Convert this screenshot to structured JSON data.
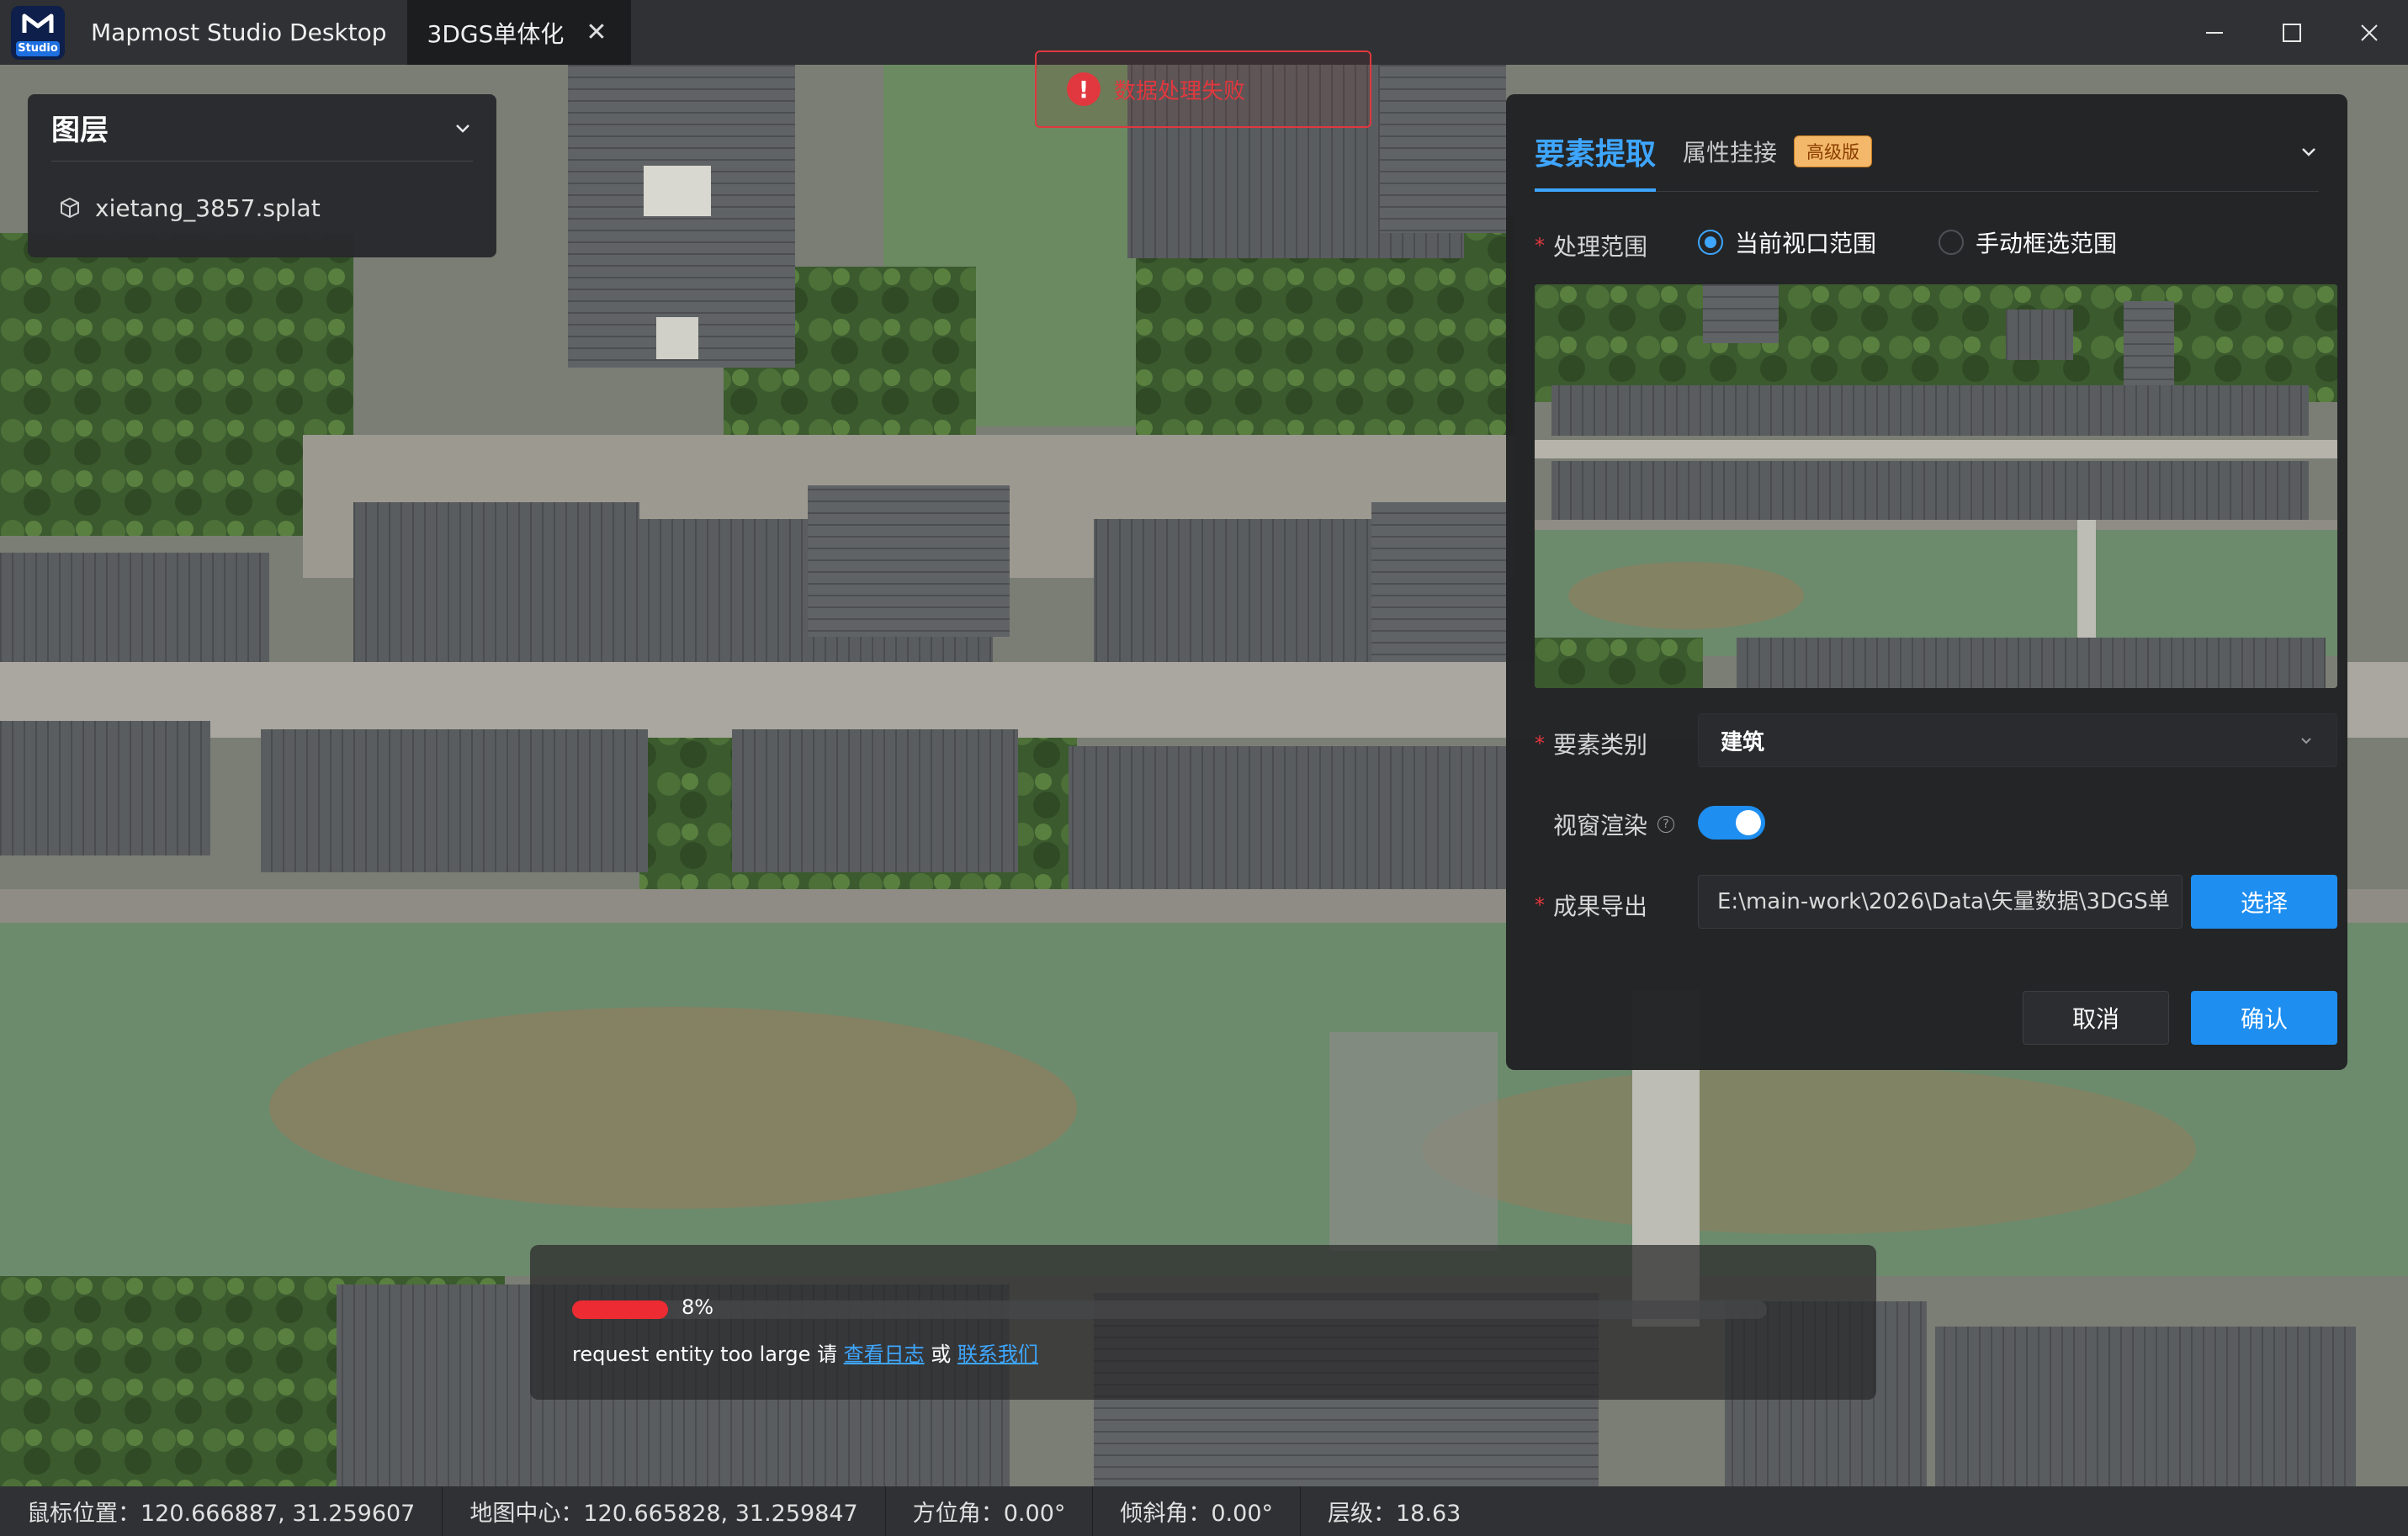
{
  "titlebar": {
    "logo_tag": "Studio",
    "app_title": "Mapmost Studio Desktop",
    "tab_label": "3DGS单体化"
  },
  "layer_panel": {
    "title": "图层",
    "items": [
      {
        "name": "xietang_3857.splat"
      }
    ]
  },
  "toast": {
    "message": "数据处理失败",
    "color": "#e0383e"
  },
  "feature_panel": {
    "tab_active": "要素提取",
    "tab_other": "属性挂接",
    "badge": "高级版",
    "range_label": "处理范围",
    "range_options": [
      "当前视口范围",
      "手动框选范围"
    ],
    "range_selected": "当前视口范围",
    "category_label": "要素类别",
    "category_value": "建筑",
    "render_label": "视窗渲染",
    "render_enabled": true,
    "export_label": "成果导出",
    "export_path": "E:\\main-work\\2026\\Data\\矢量数据\\3DGS单",
    "select_button": "选择",
    "cancel_button": "取消",
    "confirm_button": "确认",
    "accent_color": "#1e8ef0"
  },
  "progress": {
    "percent_text": "8%",
    "percent_value": 8,
    "message": "request entity too large 请 ",
    "log_link": "查看日志",
    "or_text": " 或 ",
    "contact_link": "联系我们"
  },
  "statusbar": {
    "mouse_position": "鼠标位置：120.666887, 31.259607",
    "map_center": "地图中心：120.665828, 31.259847",
    "bearing": "方位角：0.00°",
    "pitch": "倾斜角：0.00°",
    "zoom": "层级：18.63"
  }
}
